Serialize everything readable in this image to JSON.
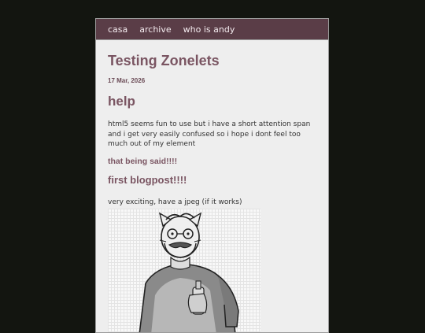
{
  "nav": {
    "items": [
      "casa",
      "archive",
      "who is andy"
    ]
  },
  "post": {
    "title": "Testing Zonelets",
    "date": "17 Mar, 2026",
    "heading_help": "help",
    "paragraph": "html5 seems fun to use but i have a short attention span and i get very easily confused so i hope i dont feel too much out of my element",
    "subheading": "that being said!!!!",
    "heading_first": "first blogpost!!!!",
    "jpeg_caption": "very exciting, have a jpeg (if it works)"
  },
  "colors": {
    "background": "#131510",
    "nav": "#5a3d47",
    "accent": "#7a5562",
    "panel": "#eeeeee"
  }
}
